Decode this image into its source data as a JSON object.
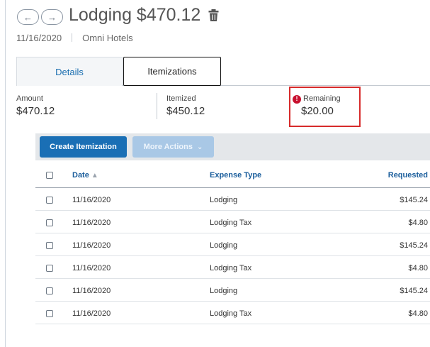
{
  "header": {
    "back_icon": "arrow-left-icon",
    "forward_icon": "arrow-right-icon",
    "back_glyph": "←",
    "forward_glyph": "→",
    "title": "Lodging $470.12",
    "delete_icon": "trash-icon",
    "date": "11/16/2020",
    "vendor": "Omni Hotels"
  },
  "tabs": [
    {
      "label": "Details",
      "selected": false
    },
    {
      "label": "Itemizations",
      "selected": true
    }
  ],
  "summary": {
    "amount_label": "Amount",
    "amount_value": "$470.12",
    "itemized_label": "Itemized",
    "itemized_value": "$450.12",
    "remaining_label": "Remaining",
    "remaining_value": "$20.00",
    "remaining_icon": "alert-icon",
    "remaining_icon_glyph": "!"
  },
  "toolbar": {
    "create_label": "Create Itemization",
    "more_label": "More Actions",
    "more_icon": "chevron-down-icon",
    "more_glyph": "⌄"
  },
  "table": {
    "headers": {
      "date": "Date",
      "sort_glyph": "▲",
      "type": "Expense Type",
      "requested": "Requested"
    },
    "rows": [
      {
        "date": "11/16/2020",
        "type": "Lodging",
        "requested": "$145.24"
      },
      {
        "date": "11/16/2020",
        "type": "Lodging Tax",
        "requested": "$4.80"
      },
      {
        "date": "11/16/2020",
        "type": "Lodging",
        "requested": "$145.24"
      },
      {
        "date": "11/16/2020",
        "type": "Lodging Tax",
        "requested": "$4.80"
      },
      {
        "date": "11/16/2020",
        "type": "Lodging",
        "requested": "$145.24"
      },
      {
        "date": "11/16/2020",
        "type": "Lodging Tax",
        "requested": "$4.80"
      }
    ]
  },
  "colors": {
    "primary_button": "#1a6fb5",
    "disabled_button": "#a9c8e6",
    "link_blue": "#1b6fb0",
    "alert_red": "#c8102e",
    "highlight_box": "#d72b2b"
  }
}
